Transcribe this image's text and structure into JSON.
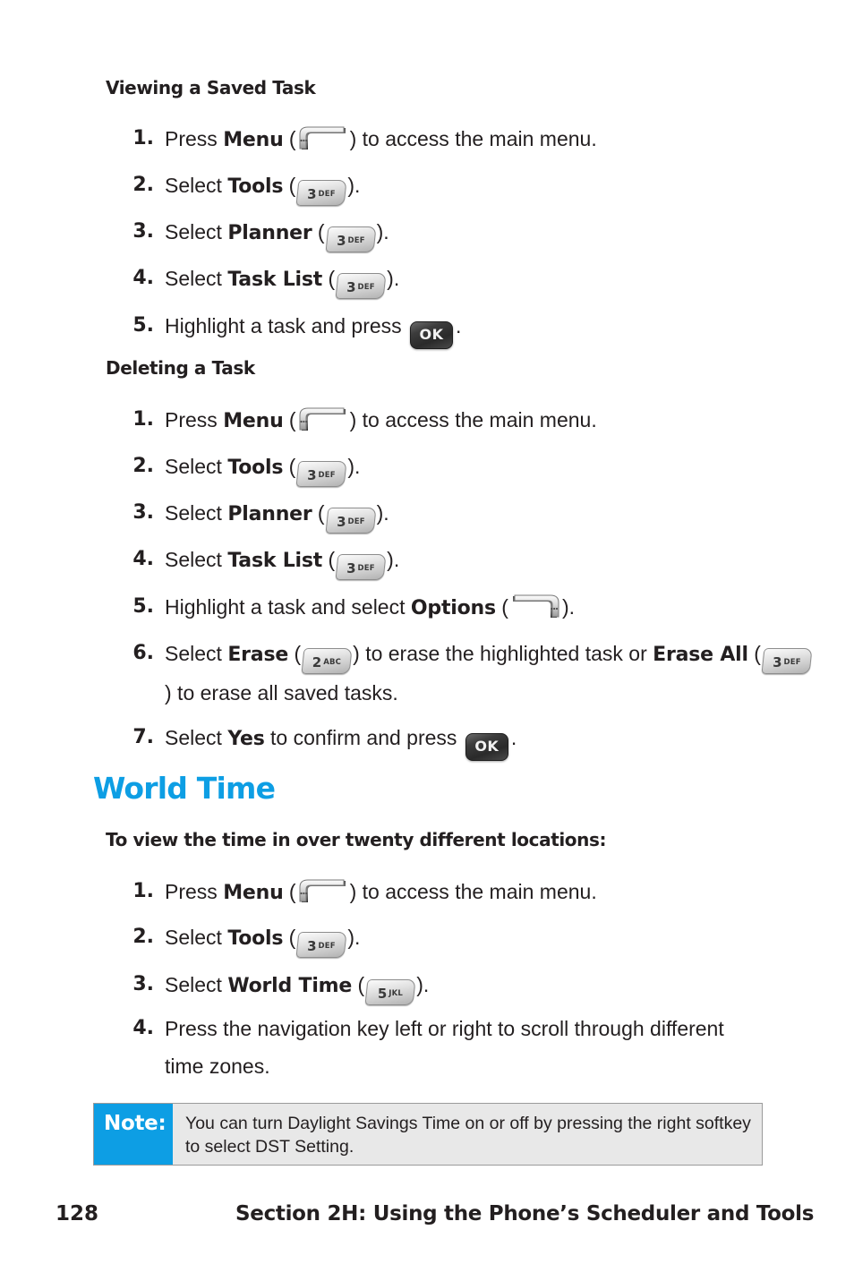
{
  "page": {
    "number": "128",
    "footer_title": "Section 2H: Using the Phone’s Scheduler and Tools",
    "accent_color": "#0d9ee4",
    "text_color": "#231f20"
  },
  "sections": [
    {
      "id": "viewing-a-saved-task",
      "heading": "Viewing a Saved Task",
      "steps": [
        {
          "num": "1.",
          "pre": "Press ",
          "bold": "Menu",
          "mid": " (",
          "icon": "left-softkey-icon",
          "post": ") to access the main menu."
        },
        {
          "num": "2.",
          "pre": "Select ",
          "bold": "Tools",
          "mid": " (",
          "icon": "key-3-def-icon",
          "post": ")."
        },
        {
          "num": "3.",
          "pre": "Select ",
          "bold": "Planner",
          "mid": " (",
          "icon": "key-3-def-icon",
          "post": ")."
        },
        {
          "num": "4.",
          "pre": "Select ",
          "bold": "Task List",
          "mid": " (",
          "icon": "key-3-def-icon",
          "post": ")."
        },
        {
          "num": "5.",
          "pre": "Highlight a task and press ",
          "bold": "",
          "mid": "",
          "icon": "key-ok-icon",
          "post": "."
        }
      ]
    },
    {
      "id": "deleting-a-task",
      "heading": "Deleting a Task",
      "steps": [
        {
          "num": "1.",
          "pre": "Press ",
          "bold": "Menu",
          "mid": " (",
          "icon": "left-softkey-icon",
          "post": ") to access the main menu."
        },
        {
          "num": "2.",
          "pre": "Select ",
          "bold": "Tools",
          "mid": " (",
          "icon": "key-3-def-icon",
          "post": ")."
        },
        {
          "num": "3.",
          "pre": "Select ",
          "bold": "Planner",
          "mid": " (",
          "icon": "key-3-def-icon",
          "post": ")."
        },
        {
          "num": "4.",
          "pre": "Select ",
          "bold": "Task List",
          "mid": " (",
          "icon": "key-3-def-icon",
          "post": ")."
        },
        {
          "num": "5.",
          "pre": "Highlight a task and select ",
          "bold": "Options",
          "mid": " (",
          "icon": "right-softkey-icon",
          "post": ")."
        },
        {
          "num": "6.",
          "pre": "Select ",
          "bold": "Erase",
          "mid": " (",
          "icon": "key-2-abc-icon",
          "post": ") to erase the highlighted task or ",
          "bold2": "Erase All",
          "mid2": " (",
          "icon2": "key-3-def-icon",
          "post2": ") to erase all saved tasks."
        },
        {
          "num": "7.",
          "pre": "Select ",
          "bold": "Yes",
          "mid": " to confirm and press ",
          "icon": "key-ok-icon",
          "post": "."
        }
      ]
    },
    {
      "id": "world-time",
      "heading": "World Time",
      "intro": "To view the time in over twenty different locations:",
      "steps": [
        {
          "num": "1.",
          "pre": "Press ",
          "bold": "Menu",
          "mid": " (",
          "icon": "left-softkey-icon",
          "post": ") to access the main menu."
        },
        {
          "num": "2.",
          "pre": "Select ",
          "bold": "Tools",
          "mid": " (",
          "icon": "key-3-def-icon",
          "post": ")."
        },
        {
          "num": "3.",
          "pre": "Select ",
          "bold": "World Time",
          "mid": " (",
          "icon": "key-5-jkl-icon",
          "post": ")."
        },
        {
          "num": "4.",
          "pre": "Press the navigation key left or right to scroll through different time zones.",
          "bold": "",
          "mid": "",
          "icon": "",
          "post": ""
        }
      ]
    }
  ],
  "keys": {
    "key2": {
      "digit": "2",
      "letters": "ABC"
    },
    "key3": {
      "digit": "3",
      "letters": "DEF"
    },
    "key5": {
      "digit": "5",
      "letters": "JKL"
    },
    "ok": {
      "label": "OK"
    }
  },
  "note": {
    "label": "Note:",
    "text": "You can turn Daylight Savings Time on or off by pressing the right softkey to select DST Setting."
  }
}
